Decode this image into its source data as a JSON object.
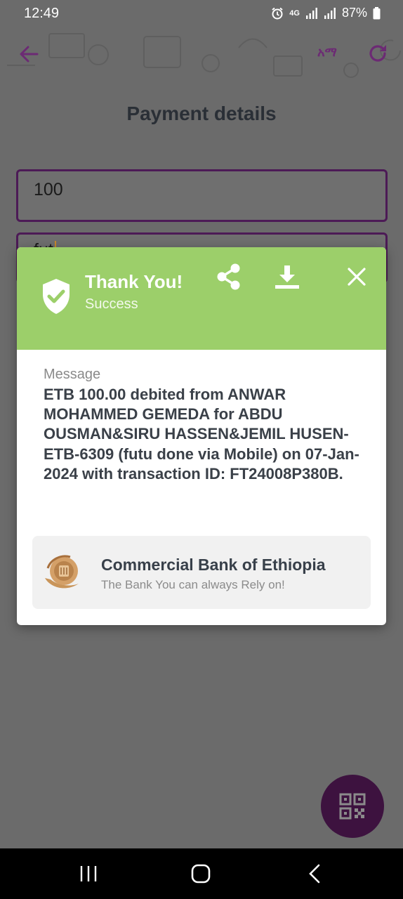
{
  "status_bar": {
    "time": "12:49",
    "network": "4G",
    "battery": "87%"
  },
  "app_bar": {
    "language_toggle": "አማ",
    "accent_color": "#6c2a74"
  },
  "page": {
    "title": "Payment details"
  },
  "form": {
    "amount_value": "100",
    "reason_value": "fut"
  },
  "dialog": {
    "title": "Thank You!",
    "subtitle": "Success",
    "header_color": "#9ccf6a",
    "message_label": "Message",
    "message_text": "ETB 100.00 debited from ANWAR MOHAMMED GEMEDA for ABDU OUSMAN&SIRU HASSEN&JEMIL HUSEN-ETB-6309 (futu done via Mobile) on 07-Jan-2024 with transaction ID: FT24008P380B.",
    "bank_name": "Commercial Bank of Ethiopia",
    "bank_tagline": "The Bank You can always Rely on!",
    "icons": [
      "shield-check-icon",
      "share-icon",
      "download-icon",
      "close-icon"
    ]
  },
  "fab": {
    "icon": "qr-code-icon",
    "color": "#3d123f"
  },
  "nav_bar": {
    "icons": [
      "recents-icon",
      "home-icon",
      "back-icon"
    ]
  }
}
